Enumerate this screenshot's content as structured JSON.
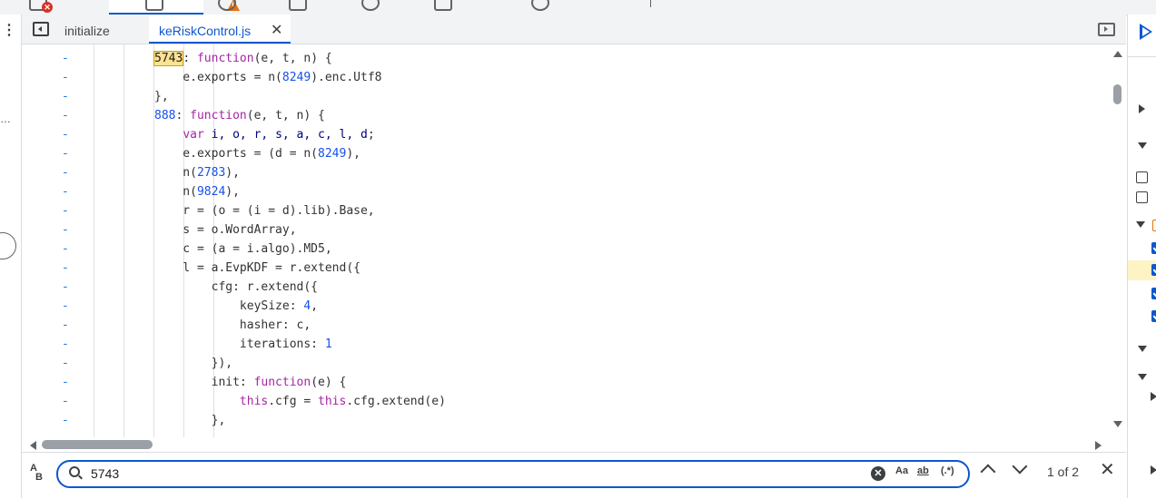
{
  "colors": {
    "accent": "#0b57d0",
    "keyword": "#a626a4",
    "number": "#1750eb",
    "match_highlight": "#fde293",
    "error": "#d93025",
    "warning": "#e8710a"
  },
  "top_tabs": {
    "icons": [
      "console-icon",
      "sources-icon",
      "network-icon",
      "performance-icon",
      "memory-icon",
      "application-icon",
      "lighthouse-icon"
    ]
  },
  "editor_tabs": [
    {
      "label": "initialize",
      "active": false
    },
    {
      "label": "keRiskControl.js",
      "active": true,
      "closable": true
    }
  ],
  "code_lines": [
    {
      "marker": "-",
      "segments": [
        {
          "t": "5743",
          "c": "hl"
        },
        {
          "t": ": ",
          "c": "fg"
        },
        {
          "t": "function",
          "c": "kw"
        },
        {
          "t": "(e, t, n) {",
          "c": "fg"
        }
      ]
    },
    {
      "marker": "-",
      "segments": [
        {
          "t": "    e.exports = n(",
          "c": "fg"
        },
        {
          "t": "8249",
          "c": "num"
        },
        {
          "t": ").enc.Utf8",
          "c": "fg"
        }
      ]
    },
    {
      "marker": "-",
      "segments": [
        {
          "t": "},",
          "c": "fg"
        }
      ]
    },
    {
      "marker": "-",
      "segments": [
        {
          "t": "888",
          "c": "num"
        },
        {
          "t": ": ",
          "c": "fg"
        },
        {
          "t": "function",
          "c": "kw"
        },
        {
          "t": "(e, t, n) {",
          "c": "fg"
        }
      ]
    },
    {
      "marker": "-",
      "segments": [
        {
          "t": "    ",
          "c": "fg"
        },
        {
          "t": "var",
          "c": "kw"
        },
        {
          "t": " ",
          "c": "fg"
        },
        {
          "t": "i, o, r, s, a, c, l, d",
          "c": "id"
        },
        {
          "t": ";",
          "c": "fg"
        }
      ]
    },
    {
      "marker": "-",
      "segments": [
        {
          "t": "    e.exports = (d = n(",
          "c": "fg"
        },
        {
          "t": "8249",
          "c": "num"
        },
        {
          "t": "),",
          "c": "fg"
        }
      ]
    },
    {
      "marker": "-",
      "segments": [
        {
          "t": "    n(",
          "c": "fg"
        },
        {
          "t": "2783",
          "c": "num"
        },
        {
          "t": "),",
          "c": "fg"
        }
      ]
    },
    {
      "marker": "-",
      "segments": [
        {
          "t": "    n(",
          "c": "fg"
        },
        {
          "t": "9824",
          "c": "num"
        },
        {
          "t": "),",
          "c": "fg"
        }
      ]
    },
    {
      "marker": "-",
      "segments": [
        {
          "t": "    r = (o = (i = d).lib).Base,",
          "c": "fg"
        }
      ]
    },
    {
      "marker": "-",
      "segments": [
        {
          "t": "    s = o.WordArray,",
          "c": "fg"
        }
      ]
    },
    {
      "marker": "-",
      "segments": [
        {
          "t": "    c = (a = i.algo).MD5,",
          "c": "fg"
        }
      ]
    },
    {
      "marker": "-",
      "segments": [
        {
          "t": "    l = a.EvpKDF = r.extend({",
          "c": "fg"
        }
      ]
    },
    {
      "marker": "-",
      "segments": [
        {
          "t": "        cfg: r.extend({",
          "c": "fg"
        }
      ]
    },
    {
      "marker": "-",
      "segments": [
        {
          "t": "            keySize: ",
          "c": "fg"
        },
        {
          "t": "4",
          "c": "num"
        },
        {
          "t": ",",
          "c": "fg"
        }
      ]
    },
    {
      "marker": "-",
      "segments": [
        {
          "t": "            hasher: c,",
          "c": "fg"
        }
      ]
    },
    {
      "marker": "-",
      "segments": [
        {
          "t": "            iterations: ",
          "c": "fg"
        },
        {
          "t": "1",
          "c": "num"
        }
      ]
    },
    {
      "marker": "-",
      "segments": [
        {
          "t": "        }),",
          "c": "fg"
        }
      ]
    },
    {
      "marker": "-",
      "segments": [
        {
          "t": "        init: ",
          "c": "fg"
        },
        {
          "t": "function",
          "c": "kw"
        },
        {
          "t": "(e) {",
          "c": "fg"
        }
      ]
    },
    {
      "marker": "-",
      "segments": [
        {
          "t": "            ",
          "c": "fg"
        },
        {
          "t": "this",
          "c": "kw"
        },
        {
          "t": ".cfg = ",
          "c": "fg"
        },
        {
          "t": "this",
          "c": "kw"
        },
        {
          "t": ".cfg.extend(e)",
          "c": "fg"
        }
      ]
    },
    {
      "marker": "-",
      "segments": [
        {
          "t": "        },",
          "c": "fg"
        }
      ]
    }
  ],
  "search": {
    "query": "5743",
    "case_label": "Aa",
    "word_label": "ab",
    "regex_label": "(.*)",
    "match_count": "1 of 2"
  }
}
